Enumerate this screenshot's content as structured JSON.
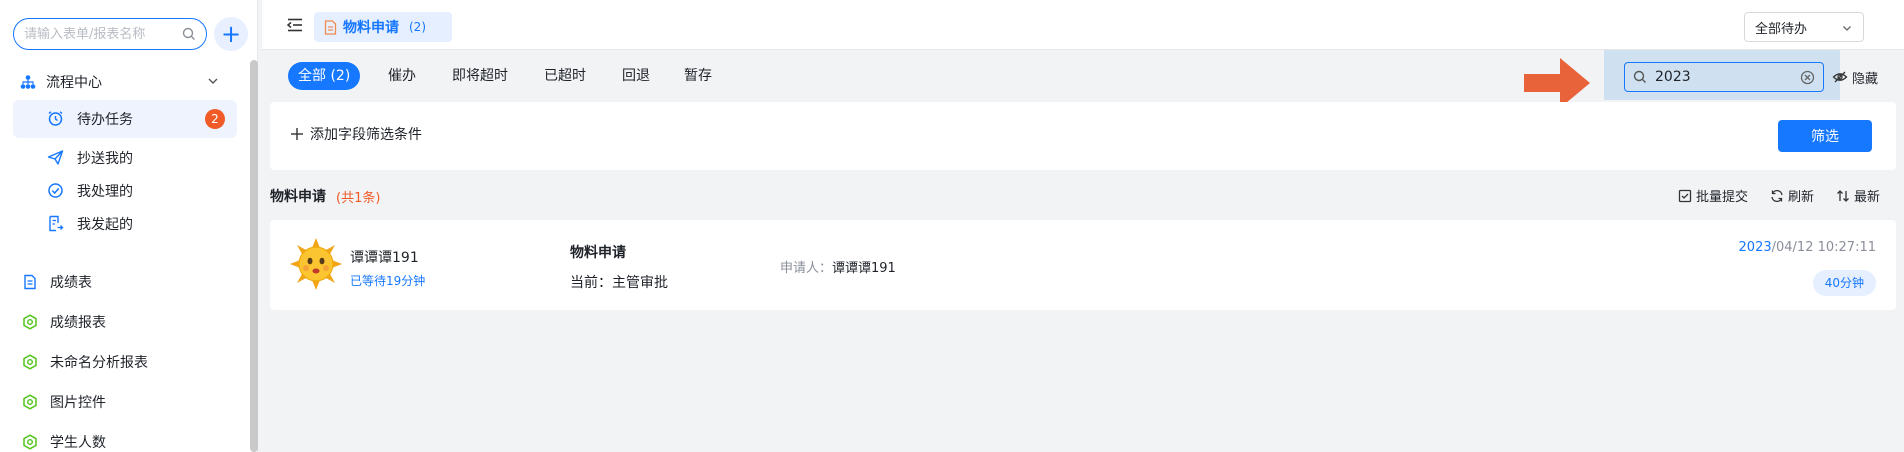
{
  "sidebar": {
    "search_placeholder": "请输入表单/报表名称",
    "add_label": "+",
    "group": {
      "label": "流程中心",
      "icon": "org-chart-icon"
    },
    "sub_items": [
      {
        "label": "待办任务",
        "icon": "alarm-clock-icon",
        "badge": "2",
        "active": true
      },
      {
        "label": "抄送我的",
        "icon": "paper-plane-icon"
      },
      {
        "label": "我处理的",
        "icon": "check-circle-icon"
      },
      {
        "label": "我发起的",
        "icon": "doc-arrow-icon"
      }
    ],
    "items": [
      {
        "label": "成绩表",
        "icon": "document-icon"
      },
      {
        "label": "成绩报表",
        "icon": "hexagon-icon"
      },
      {
        "label": "未命名分析报表",
        "icon": "hexagon-icon"
      },
      {
        "label": "图片控件",
        "icon": "hexagon-icon"
      },
      {
        "label": "学生人数",
        "icon": "hexagon-icon"
      }
    ]
  },
  "topbar": {
    "tab_label": "物料申请",
    "tab_count": "(2)",
    "select_value": "全部待办"
  },
  "tabs": [
    {
      "label": "全部 (2)",
      "active": true
    },
    {
      "label": "催办"
    },
    {
      "label": "即将超时"
    },
    {
      "label": "已超时"
    },
    {
      "label": "回退"
    },
    {
      "label": "暂存"
    }
  ],
  "search": {
    "value": "2023"
  },
  "hide_label": "隐藏",
  "filter": {
    "add_label": "添加字段筛选条件",
    "button_label": "筛选"
  },
  "list": {
    "title": "物料申请",
    "count": "(共1条)",
    "actions": {
      "batch_submit": "批量提交",
      "refresh": "刷新",
      "latest": "最新"
    }
  },
  "task": {
    "user_name": "谭谭谭191",
    "wait_time": "已等待19分钟",
    "form_name": "物料申请",
    "stage": "当前：主管审批",
    "applicant_label": "申请人：",
    "applicant_name": "谭谭谭191",
    "date_highlight": "2023",
    "date_rest": "/04/12 10:27:11",
    "duration": "40分钟"
  },
  "colors": {
    "primary": "#1677ff",
    "badge": "#f05b28",
    "arrow": "#e8623a",
    "search_highlight": "#cfe1f1",
    "sidebar_hexagon": "#52c41a"
  }
}
